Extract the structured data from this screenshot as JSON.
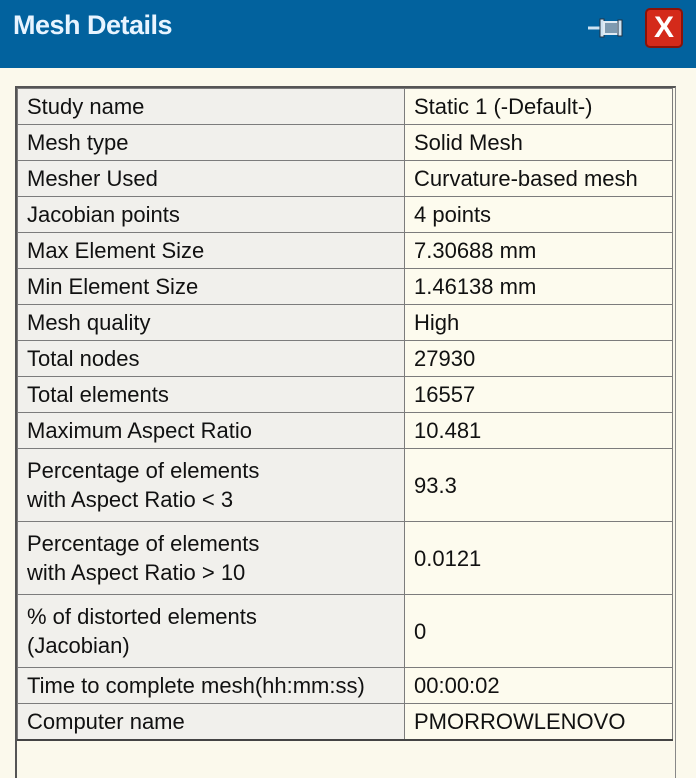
{
  "window": {
    "title": "Mesh Details",
    "pin_icon": "pin-icon",
    "close_icon": "close-icon",
    "close_label": "X"
  },
  "rows": [
    {
      "label": "Study name",
      "value": "Static 1 (-Default-)"
    },
    {
      "label": "Mesh type",
      "value": "Solid Mesh"
    },
    {
      "label": "Mesher Used",
      "value": "Curvature-based mesh"
    },
    {
      "label": "Jacobian points",
      "value": "4 points"
    },
    {
      "label": "Max Element Size",
      "value": "7.30688 mm"
    },
    {
      "label": "Min Element Size",
      "value": "1.46138 mm"
    },
    {
      "label": "Mesh quality",
      "value": "High"
    },
    {
      "label": "Total nodes",
      "value": "27930"
    },
    {
      "label": "Total elements",
      "value": "16557"
    },
    {
      "label": "Maximum Aspect Ratio",
      "value": "10.481"
    },
    {
      "label": "Percentage of elements",
      "label2": "with Aspect Ratio < 3",
      "value": "93.3"
    },
    {
      "label": "Percentage of elements",
      "label2": "with Aspect Ratio > 10",
      "value": "0.0121"
    },
    {
      "label": "% of distorted elements",
      "label2": "(Jacobian)",
      "value": "0"
    },
    {
      "label": "Time to complete mesh(hh:mm:ss)",
      "value": "00:00:02"
    },
    {
      "label": "Computer name",
      "value": "PMORROWLENOVO"
    }
  ]
}
